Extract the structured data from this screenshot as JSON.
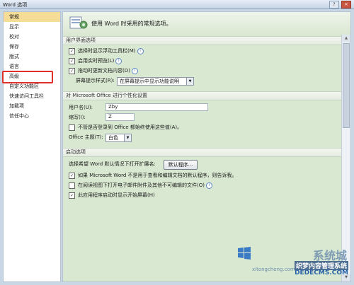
{
  "window": {
    "title": "Word 选项"
  },
  "sidebar": {
    "items": [
      {
        "label": "常规"
      },
      {
        "label": "显示"
      },
      {
        "label": "校对"
      },
      {
        "label": "保存"
      },
      {
        "label": "版式"
      },
      {
        "label": "语言"
      },
      {
        "label": "高级"
      },
      {
        "label": "自定义功能区"
      },
      {
        "label": "快速访问工具栏"
      },
      {
        "label": "加载项"
      },
      {
        "label": "信任中心"
      }
    ],
    "active_index": 0,
    "highlighted_index": 6
  },
  "header": {
    "text": "使用 Word 时采用的常规选项。"
  },
  "ui_section": {
    "title": "用户界面选项",
    "mini_toolbar": "选择时显示浮动工具栏(M)",
    "live_preview": "启用实时预览(L)",
    "drag_update": "拖动时更新文档内容(D)",
    "screentip_label": "屏幕提示样式(R):",
    "screentip_value": "在屏幕提示中显示功能说明"
  },
  "personalize": {
    "title": "对 Microsoft Office 进行个性化设置",
    "username_label": "用户名(U):",
    "username_value": "Zby",
    "initials_label": "缩写(I):",
    "initials_value": "Z",
    "always_use": "不管是否登录到 Office 都始终使用这些值(A)。",
    "theme_label": "Office 主题(T):",
    "theme_value": "白色"
  },
  "startup": {
    "title": "启动选项",
    "ext_label": "选择希望 Word 默认情况下打开扩展名:",
    "default_btn": "默认程序...",
    "tell_me": "如果 Microsoft Word 不是用于查看和编辑文档的默认程序，则告诉我。",
    "reading_view": "在阅读视图下打开电子邮件附件及其他不可编辑的文件(O)",
    "start_screen": "此应用程序启动时显示开始屏幕(H)"
  },
  "watermark": {
    "brand": "系统城",
    "line1": "织梦内容管理系统",
    "line2": "DEDECMS.COM",
    "line3": "xitongcheng.com"
  },
  "icons": {
    "close": "close-icon",
    "minimize": "minimize-icon",
    "help": "help-icon"
  }
}
